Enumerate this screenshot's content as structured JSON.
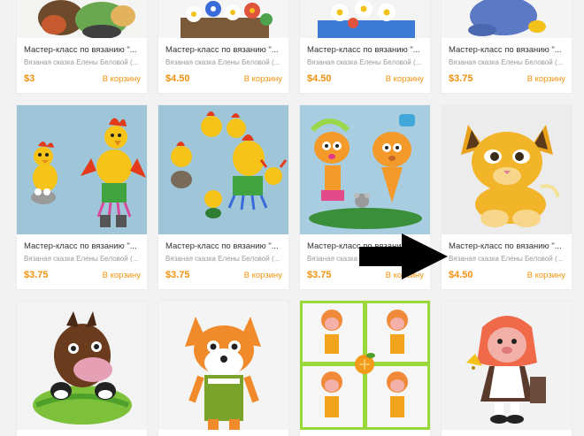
{
  "rows": [
    {
      "cards": [
        {
          "title": "Мастер-класс по вязанию \"...",
          "seller": "Вязаная сказка Елены Беловой (...",
          "price": "$3",
          "cart": "В корзину",
          "image": "knit-toy-brown-bear"
        },
        {
          "title": "Мастер-класс по вязанию \"...",
          "seller": "Вязаная сказка Елены Беловой (...",
          "price": "$4.50",
          "cart": "В корзину",
          "image": "knit-flowers-basket"
        },
        {
          "title": "Мастер-класс по вязанию \"...",
          "seller": "Вязаная сказка Елены Беловой (...",
          "price": "$4.50",
          "cart": "В корзину",
          "image": "knit-flowers-teapot"
        },
        {
          "title": "Мастер-класс по вязанию \"...",
          "seller": "Вязаная сказка Елены Беловой (...",
          "price": "$3.75",
          "cart": "В корзину",
          "image": "knit-blue-toy"
        }
      ]
    },
    {
      "cards": [
        {
          "title": "Мастер-класс по вязанию \"...",
          "seller": "Вязаная сказка Елены Беловой (...",
          "price": "$3.75",
          "cart": "В корзину",
          "image": "knit-roosters"
        },
        {
          "title": "Мастер-класс по вязанию \"...",
          "seller": "Вязаная сказка Елены Беловой (...",
          "price": "$3.75",
          "cart": "В корзину",
          "image": "knit-rooster-family"
        },
        {
          "title": "Мастер-класс по вязанию \"...",
          "seller": "Вязаная сказка Елены Беловой (...",
          "price": "$3.75",
          "cart": "В корзину",
          "image": "knit-carrot-couple"
        },
        {
          "title": "Мастер-класс по вязанию \"...",
          "seller": "Вязаная сказка Елены Беловой (...",
          "price": "$4.50",
          "cart": "В корзину",
          "image": "knit-lion-cub"
        }
      ]
    },
    {
      "cards": [
        {
          "image": "knit-horse"
        },
        {
          "image": "knit-fox"
        },
        {
          "image": "knit-orange-girls-collage"
        },
        {
          "image": "knit-girl-with-bell"
        }
      ]
    }
  ],
  "overlay": {
    "arrow": "arrow-right-icon"
  },
  "colors": {
    "accent": "#f0920e",
    "background": "#f2f2f2"
  }
}
